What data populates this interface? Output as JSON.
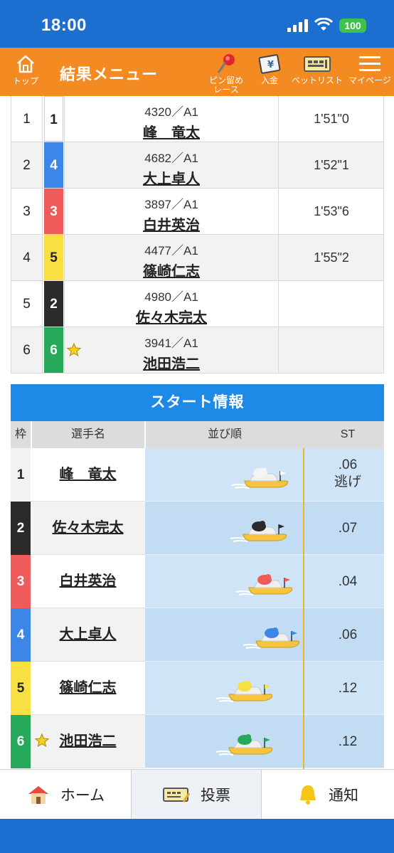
{
  "status": {
    "time": "18:00",
    "battery": "100"
  },
  "header": {
    "home_label": "トップ",
    "title": "結果メニュー",
    "pin_label_1": "ピン留め",
    "pin_label_2": "レース",
    "deposit_label": "入金",
    "betlist_label": "ベットリスト",
    "mypage_label": "マイページ"
  },
  "colors": {
    "header": "#f48a22",
    "status": "#1c6fd1",
    "section": "#1c8ae6",
    "lane1": "#ffffff",
    "lane2": "#2b2b2b",
    "lane3": "#ef5a5a",
    "lane4": "#3c86e8",
    "lane5": "#f8e042",
    "lane6": "#27a95b"
  },
  "results": [
    {
      "rank": "1",
      "lane": "1",
      "regno": "4320／A1",
      "name": "峰　竜太",
      "time": "1'51\"0"
    },
    {
      "rank": "2",
      "lane": "4",
      "regno": "4682／A1",
      "name": "大上卓人",
      "time": "1'52\"1"
    },
    {
      "rank": "3",
      "lane": "3",
      "regno": "3897／A1",
      "name": "白井英治",
      "time": "1'53\"6"
    },
    {
      "rank": "4",
      "lane": "5",
      "regno": "4477／A1",
      "name": "篠崎仁志",
      "time": "1'55\"2"
    },
    {
      "rank": "5",
      "lane": "2",
      "regno": "4980／A1",
      "name": "佐々木完太",
      "time": ""
    },
    {
      "rank": "6",
      "lane": "6",
      "regno": "3941／A1",
      "name": "池田浩二",
      "time": ""
    }
  ],
  "start_info": {
    "title": "スタート情報",
    "headers": {
      "lane": "枠",
      "name": "選手名",
      "order": "並び順",
      "st": "ST"
    },
    "rows": [
      {
        "lane": "1",
        "name": "峰　竜太",
        "st": ".06",
        "note": "逃げ"
      },
      {
        "lane": "2",
        "name": "佐々木完太",
        "st": ".07",
        "note": ""
      },
      {
        "lane": "3",
        "name": "白井英治",
        "st": ".04",
        "note": ""
      },
      {
        "lane": "4",
        "name": "大上卓人",
        "st": ".06",
        "note": ""
      },
      {
        "lane": "5",
        "name": "篠崎仁志",
        "st": ".12",
        "note": ""
      },
      {
        "lane": "6",
        "name": "池田浩二",
        "st": ".12",
        "note": ""
      }
    ]
  },
  "tabs": {
    "home": "ホーム",
    "vote": "投票",
    "notify": "通知"
  },
  "icons": [
    "home-icon",
    "pin-icon",
    "deposit-icon",
    "betlist-icon",
    "menu-icon",
    "star-icon",
    "boat-icon",
    "house-icon",
    "ticket-icon",
    "bell-icon"
  ]
}
